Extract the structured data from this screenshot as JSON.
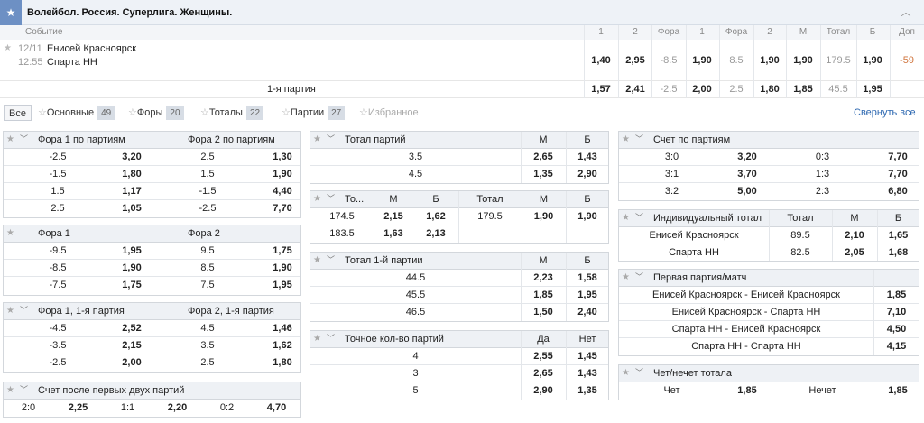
{
  "header": {
    "title": "Волейбол. Россия. Суперлига. Женщины."
  },
  "event_cols": {
    "event": "Событие",
    "c": [
      "1",
      "2",
      "Фора",
      "1",
      "Фора",
      "2",
      "М",
      "Тотал",
      "Б",
      "Доп"
    ]
  },
  "event": {
    "date": "12/11",
    "time": "12:55",
    "team1": "Енисей Красноярск",
    "team2": "Спарта НН",
    "odds": [
      "1,40",
      "2,95",
      "-8.5",
      "1,90",
      "8.5",
      "1,90",
      "1,90",
      "179.5",
      "1,90",
      "-59"
    ]
  },
  "set1": {
    "label": "1-я партия",
    "odds": [
      "1,57",
      "2,41",
      "-2.5",
      "2,00",
      "2.5",
      "1,80",
      "1,85",
      "45.5",
      "1,95",
      ""
    ]
  },
  "filters": {
    "all": "Все",
    "main": "Основные",
    "main_n": "49",
    "fora": "Форы",
    "fora_n": "20",
    "totals": "Тоталы",
    "totals_n": "22",
    "parts": "Партии",
    "parts_n": "27",
    "fav": "Избранное",
    "collapse": "Свернуть все"
  },
  "t1": {
    "h1": "Фора 1 по партиям",
    "h2": "Фора 2 по партиям",
    "rows": [
      [
        "-2.5",
        "3,20",
        "2.5",
        "1,30"
      ],
      [
        "-1.5",
        "1,80",
        "1.5",
        "1,90"
      ],
      [
        "1.5",
        "1,17",
        "-1.5",
        "4,40"
      ],
      [
        "2.5",
        "1,05",
        "-2.5",
        "7,70"
      ]
    ]
  },
  "t2": {
    "h1": "Фора 1",
    "h2": "Фора 2",
    "rows": [
      [
        "-9.5",
        "1,95",
        "9.5",
        "1,75"
      ],
      [
        "-8.5",
        "1,90",
        "8.5",
        "1,90"
      ],
      [
        "-7.5",
        "1,75",
        "7.5",
        "1,95"
      ]
    ]
  },
  "t3": {
    "h1": "Фора 1, 1-я партия",
    "h2": "Фора 2, 1-я партия",
    "rows": [
      [
        "-4.5",
        "2,52",
        "4.5",
        "1,46"
      ],
      [
        "-3.5",
        "2,15",
        "3.5",
        "1,62"
      ],
      [
        "-2.5",
        "2,00",
        "2.5",
        "1,80"
      ]
    ]
  },
  "t4": {
    "h1": "Счет после первых двух партий",
    "row": [
      "2:0",
      "2,25",
      "1:1",
      "2,20",
      "0:2",
      "4,70"
    ]
  },
  "m1": {
    "h": "Тотал партий",
    "hm": "М",
    "hb": "Б",
    "rows": [
      [
        "3.5",
        "2,65",
        "1,43"
      ],
      [
        "4.5",
        "1,35",
        "2,90"
      ]
    ]
  },
  "m2": {
    "h": [
      "То...",
      "М",
      "Б",
      "Тотал",
      "М",
      "Б"
    ],
    "rows": [
      [
        "174.5",
        "2,15",
        "1,62",
        "179.5",
        "1,90",
        "1,90"
      ],
      [
        "183.5",
        "1,63",
        "2,13",
        "",
        "",
        ""
      ]
    ]
  },
  "m3": {
    "h": "Тотал 1-й партии",
    "hm": "М",
    "hb": "Б",
    "rows": [
      [
        "44.5",
        "2,23",
        "1,58"
      ],
      [
        "45.5",
        "1,85",
        "1,95"
      ],
      [
        "46.5",
        "1,50",
        "2,40"
      ]
    ]
  },
  "m4": {
    "h": "Точное кол-во партий",
    "hm": "Да",
    "hb": "Нет",
    "rows": [
      [
        "4",
        "2,55",
        "1,45"
      ],
      [
        "3",
        "2,65",
        "1,43"
      ],
      [
        "5",
        "2,90",
        "1,35"
      ]
    ]
  },
  "r1": {
    "h": "Счет по партиям",
    "rows": [
      [
        "3:0",
        "3,20",
        "0:3",
        "7,70"
      ],
      [
        "3:1",
        "3,70",
        "1:3",
        "7,70"
      ],
      [
        "3:2",
        "5,00",
        "2:3",
        "6,80"
      ]
    ]
  },
  "r2": {
    "h": "Индивидуальный тотал",
    "h2": "Тотал",
    "hm": "М",
    "hb": "Б",
    "rows": [
      [
        "Енисей Красноярск",
        "89.5",
        "2,10",
        "1,65"
      ],
      [
        "Спарта НН",
        "82.5",
        "2,05",
        "1,68"
      ]
    ]
  },
  "r3": {
    "h": "Первая партия/матч",
    "rows": [
      [
        "Енисей Красноярск - Енисей Красноярск",
        "1,85"
      ],
      [
        "Енисей Красноярск - Спарта НН",
        "7,10"
      ],
      [
        "Спарта НН - Енисей Красноярск",
        "4,50"
      ],
      [
        "Спарта НН - Спарта НН",
        "4,15"
      ]
    ]
  },
  "r4": {
    "h": "Чет/нечет тотала",
    "row": [
      "Чет",
      "1,85",
      "Нечет",
      "1,85"
    ]
  }
}
